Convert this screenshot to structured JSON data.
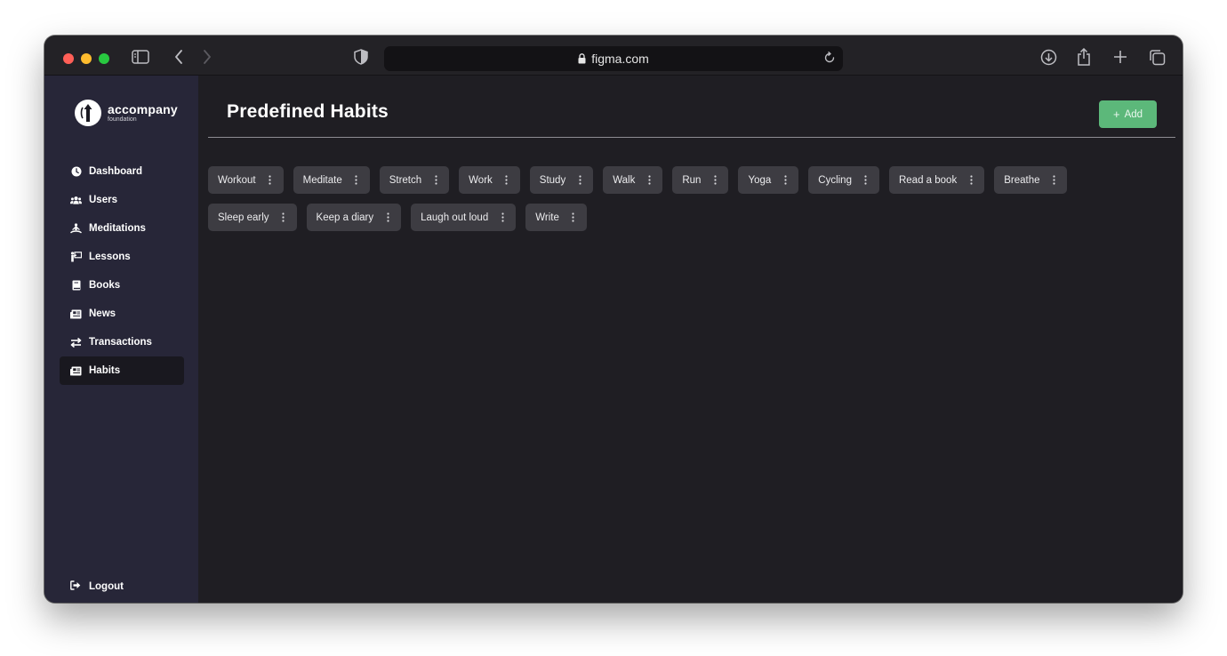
{
  "browser": {
    "url": "figma.com"
  },
  "brand": {
    "name": "accompany",
    "tagline": "foundation"
  },
  "sidebar": {
    "items": [
      {
        "label": "Dashboard",
        "icon": "clock-icon"
      },
      {
        "label": "Users",
        "icon": "users-icon"
      },
      {
        "label": "Meditations",
        "icon": "meditation-icon"
      },
      {
        "label": "Lessons",
        "icon": "lesson-icon"
      },
      {
        "label": "Books",
        "icon": "book-icon"
      },
      {
        "label": "News",
        "icon": "newspaper-icon"
      },
      {
        "label": "Transactions",
        "icon": "exchange-icon"
      },
      {
        "label": "Habits",
        "icon": "newspaper-icon",
        "active": true
      }
    ],
    "logout_label": "Logout"
  },
  "main": {
    "title": "Predefined Habits",
    "add_label": "Add",
    "habits_row1": [
      "Workout",
      "Meditate",
      "Stretch",
      "Work",
      "Study",
      "Walk",
      "Run",
      "Yoga",
      "Cycling",
      "Read a book",
      "Breathe"
    ],
    "habits_row2": [
      "Sleep early",
      "Keep a diary",
      "Laugh out loud",
      "Write"
    ]
  },
  "colors": {
    "accent": "#5cb87a",
    "sidebar_bg": "#272638",
    "main_bg": "#1f1e23",
    "chip_bg": "#3d3c42"
  }
}
